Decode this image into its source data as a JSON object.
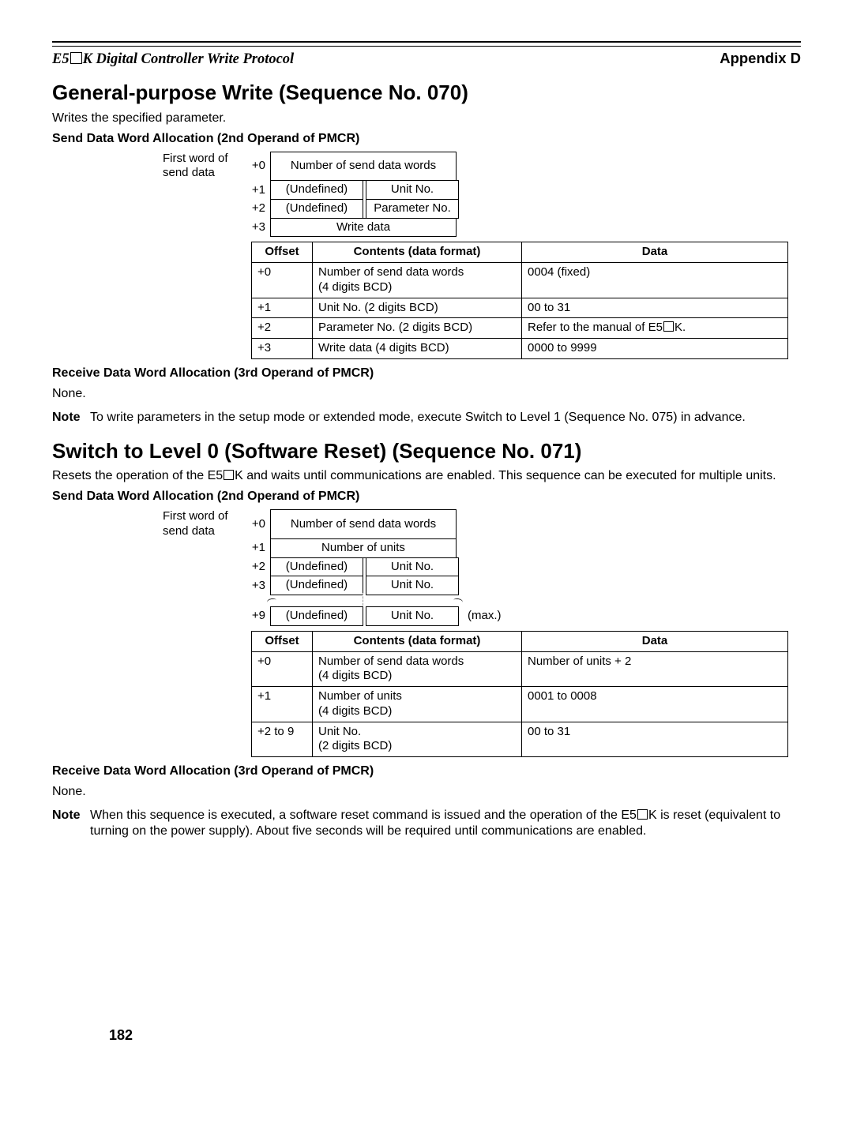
{
  "header": {
    "left_prefix": "E5",
    "left_suffix": "K Digital Controller Write Protocol",
    "right": "Appendix D"
  },
  "sec070": {
    "title": "General-purpose Write (Sequence No. 070)",
    "intro": "Writes the specified parameter.",
    "send_heading": "Send Data Word Allocation (2nd Operand of PMCR)",
    "first_word_label_l1": "First word of",
    "first_word_label_l2": "send data",
    "alloc": {
      "o0": "+0",
      "r0": "Number of send data words",
      "o1": "+1",
      "r1a": "(Undefined)",
      "r1b": "Unit No.",
      "o2": "+2",
      "r2a": "(Undefined)",
      "r2b": "Parameter No.",
      "o3": "+3",
      "r3": "Write data"
    },
    "table_head": {
      "c1": "Offset",
      "c2": "Contents (data format)",
      "c3": "Data"
    },
    "table_rows": [
      {
        "c1": "+0",
        "c2": "Number of send data words\n(4 digits BCD)",
        "c3": "0004 (fixed)"
      },
      {
        "c1": "+1",
        "c2": "Unit No. (2 digits BCD)",
        "c3": "00 to 31"
      },
      {
        "c1": "+2",
        "c2": "Parameter No. (2 digits BCD)",
        "c3_pre": "Refer to the manual of E5",
        "c3_post": "K."
      },
      {
        "c1": "+3",
        "c2": "Write data (4 digits BCD)",
        "c3": "0000 to 9999"
      }
    ],
    "recv_heading": "Receive Data Word Allocation (3rd Operand of PMCR)",
    "recv_body": "None.",
    "note": "To write parameters in the setup mode or extended mode, execute Switch to Level 1 (Sequence No. 075) in advance."
  },
  "sec071": {
    "title": "Switch to Level 0 (Software Reset) (Sequence No. 071)",
    "intro_pre": "Resets the operation of the E5",
    "intro_post": "K and waits until communications are enabled. This sequence can be executed for multiple units.",
    "send_heading": "Send Data Word Allocation (2nd Operand of PMCR)",
    "first_word_label_l1": "First word of",
    "first_word_label_l2": "send data",
    "alloc": {
      "o0": "+0",
      "r0": "Number of send data words",
      "o1": "+1",
      "r1": "Number of units",
      "o2": "+2",
      "r2a": "(Undefined)",
      "r2b": "Unit No.",
      "o3": "+3",
      "r3a": "(Undefined)",
      "r3b": "Unit No.",
      "o9": "+9",
      "r9a": "(Undefined)",
      "r9b": "Unit No.",
      "max": "(max.)"
    },
    "table_head": {
      "c1": "Offset",
      "c2": "Contents (data format)",
      "c3": "Data"
    },
    "table_rows": [
      {
        "c1": "+0",
        "c2": "Number of send data words\n(4 digits BCD)",
        "c3": "Number of units + 2"
      },
      {
        "c1": "+1",
        "c2": "Number of units\n(4 digits BCD)",
        "c3": "0001 to 0008"
      },
      {
        "c1": "+2 to 9",
        "c2": "Unit No.\n(2 digits BCD)",
        "c3": "00 to 31"
      }
    ],
    "recv_heading": "Receive Data Word Allocation (3rd Operand of PMCR)",
    "recv_body": "None.",
    "note_pre": "When this sequence is executed, a software reset command is issued and the operation of the E5",
    "note_post": "K is reset (equivalent to turning on the power supply). About five seconds will be required until communications are enabled."
  },
  "labels": {
    "note": "Note"
  },
  "page_number": "182"
}
